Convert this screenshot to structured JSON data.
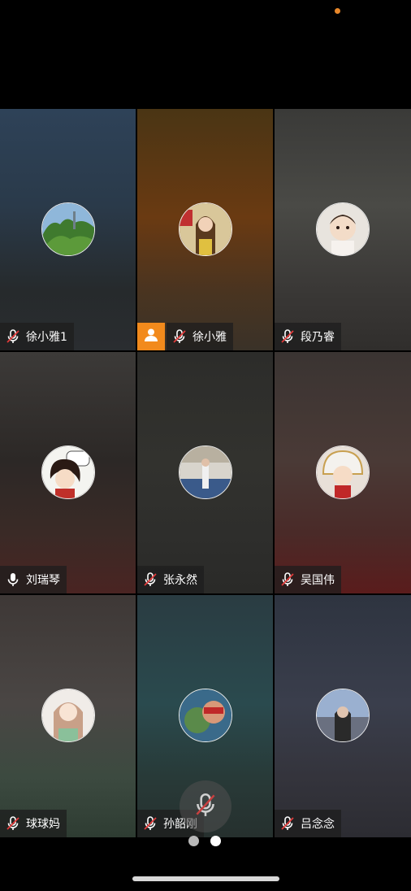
{
  "participants": [
    {
      "name": "徐小雅1",
      "mic": "muted"
    },
    {
      "name": "徐小雅",
      "mic": "muted",
      "host": true
    },
    {
      "name": "段乃睿",
      "mic": "muted"
    },
    {
      "name": "刘瑞琴",
      "mic": "on"
    },
    {
      "name": "张永然",
      "mic": "muted"
    },
    {
      "name": "吴国伟",
      "mic": "muted"
    },
    {
      "name": "球球妈",
      "mic": "muted"
    },
    {
      "name": "孙韶刚",
      "mic": "muted"
    },
    {
      "name": "吕念念",
      "mic": "muted"
    }
  ],
  "controls": {
    "mute_icon": "mic-muted-icon"
  },
  "pager": {
    "pages": 2,
    "current": 2
  },
  "colors": {
    "host_badge": "#f28a1c",
    "status_dot": "#e8872a"
  }
}
